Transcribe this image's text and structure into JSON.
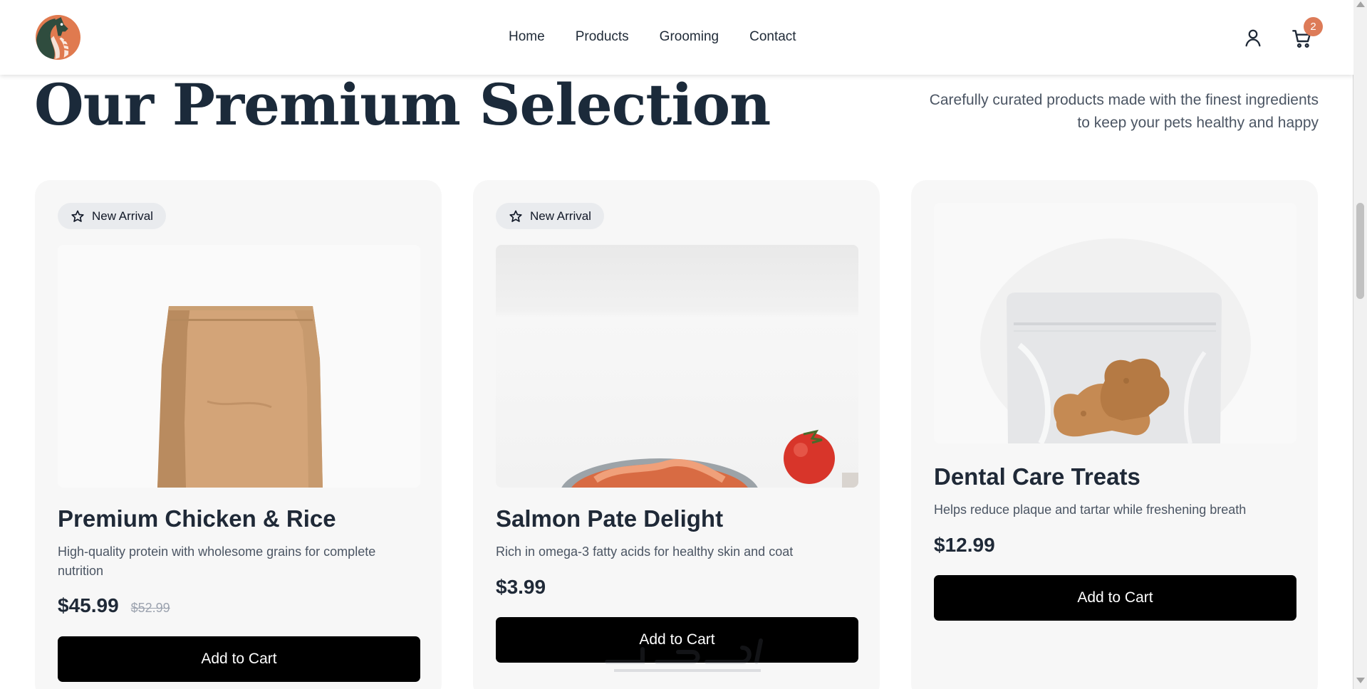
{
  "header": {
    "logo": "dog-logo",
    "nav": [
      "Home",
      "Products",
      "Grooming",
      "Contact"
    ],
    "user_icon": "user-icon",
    "cart_icon": "cart-icon",
    "cart_count": "2"
  },
  "section": {
    "title": "Our Premium Selection",
    "subtitle": "Carefully curated products made with the finest ingredients to keep your pets healthy and happy"
  },
  "products": [
    {
      "badge": "New Arrival",
      "title": "Premium Chicken & Rice",
      "description": "High-quality protein with wholesome grains for complete nutrition",
      "price": "$45.99",
      "old_price": "$52.99",
      "button": "Add to Cart",
      "image": "kraft-paper-food-bag"
    },
    {
      "badge": "New Arrival",
      "title": "Salmon Pate Delight",
      "description": "Rich in omega-3 fatty acids for healthy skin and coat",
      "price": "$3.99",
      "button": "Add to Cart",
      "image": "bowl-of-salmon-with-tomato"
    },
    {
      "title": "Dental Care Treats",
      "description": "Helps reduce plaque and tartar while freshening breath",
      "price": "$12.99",
      "button": "Add to Cart",
      "image": "bone-treats-in-clear-pouch"
    }
  ],
  "colors": {
    "accent": "#dd7b58",
    "heading": "#1b2a3a",
    "button": "#000000",
    "card": "#f7f7f7"
  }
}
